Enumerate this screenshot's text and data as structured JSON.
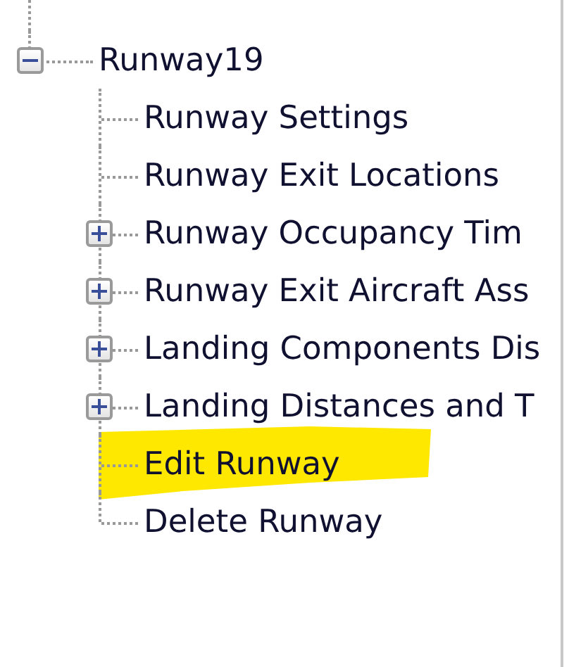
{
  "tree": {
    "label": "Runway19",
    "expanded": true,
    "children": [
      {
        "label": "Runway Settings",
        "kind": "leaf",
        "highlighted": false
      },
      {
        "label": "Runway Exit Locations",
        "kind": "leaf",
        "highlighted": false
      },
      {
        "label": "Runway Occupancy Tim",
        "kind": "group",
        "expanded": false,
        "highlighted": false
      },
      {
        "label": "Runway Exit Aircraft Ass",
        "kind": "group",
        "expanded": false,
        "highlighted": false
      },
      {
        "label": "Landing Components Dis",
        "kind": "group",
        "expanded": false,
        "highlighted": false
      },
      {
        "label": "Landing Distances and T",
        "kind": "group",
        "expanded": false,
        "highlighted": false
      },
      {
        "label": "Edit Runway",
        "kind": "leaf",
        "highlighted": true
      },
      {
        "label": "Delete Runway",
        "kind": "leaf",
        "highlighted": false
      }
    ]
  }
}
